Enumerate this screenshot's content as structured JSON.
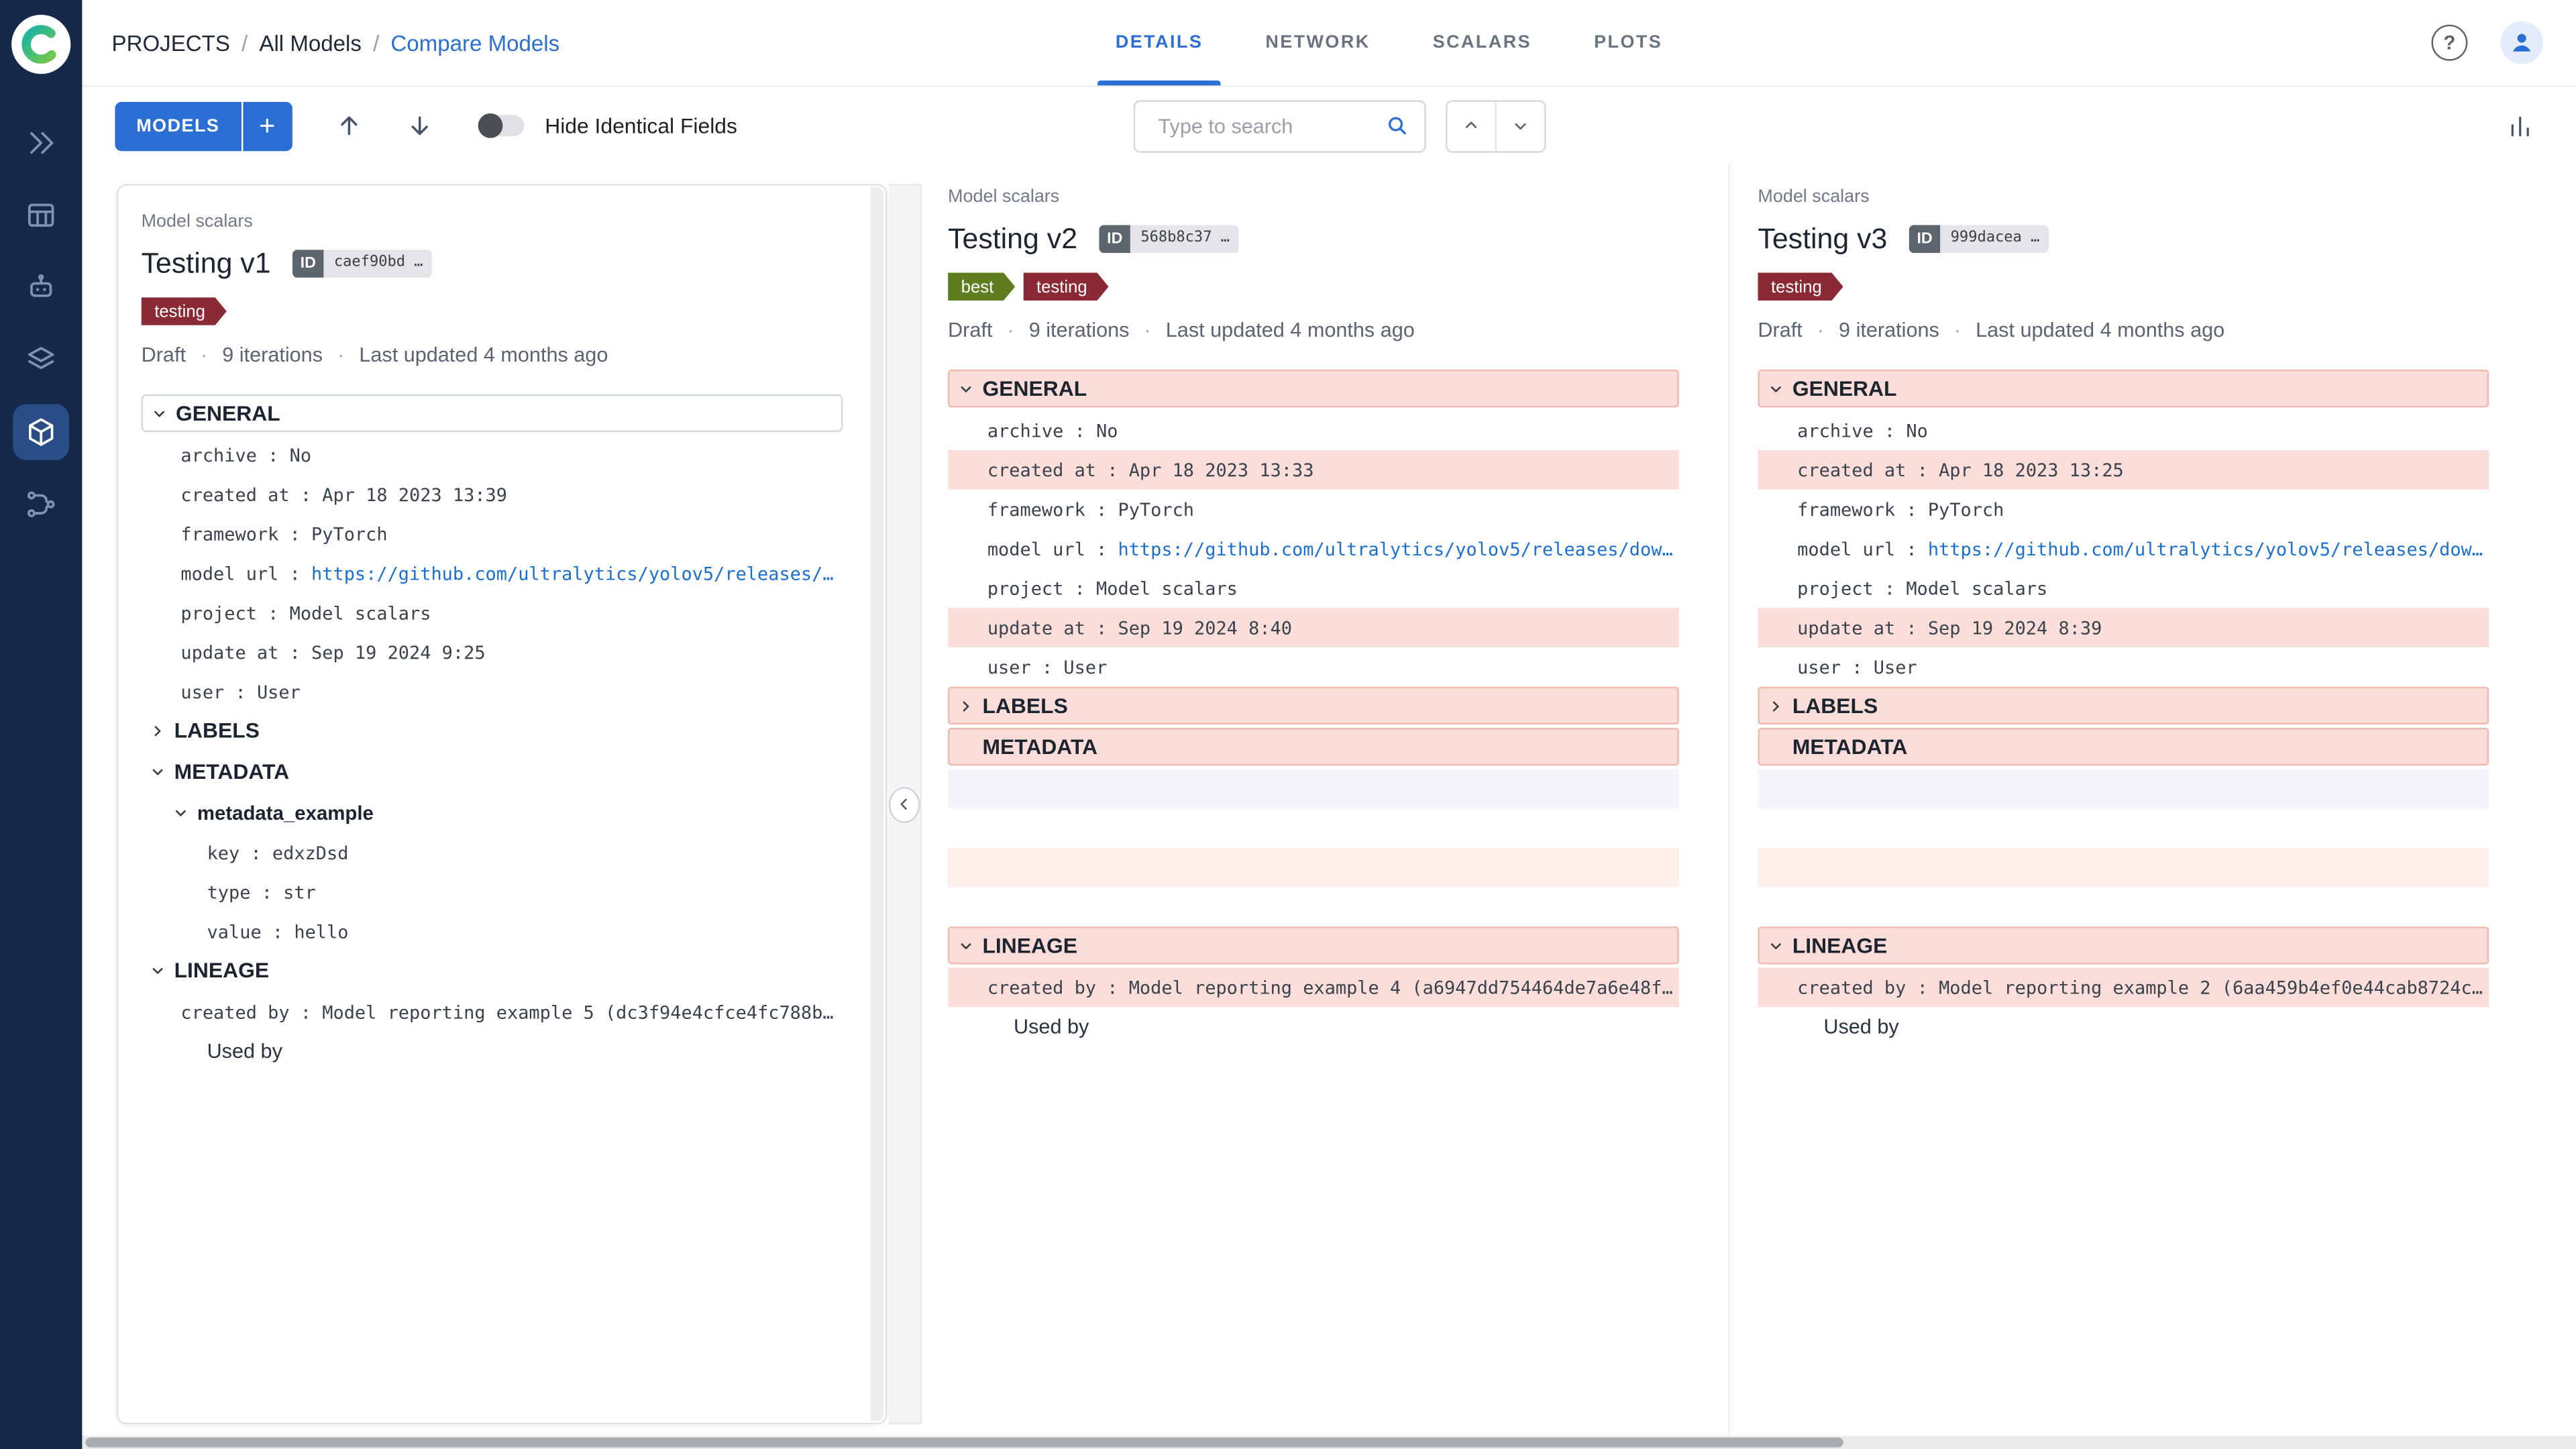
{
  "colors": {
    "accent": "#2b6fd4",
    "sidebar_bg": "#17294b",
    "diff_header_bg": "#fadcd8",
    "diff_row_bg": "#fbdeda",
    "tag_testing": "#8a2a35",
    "tag_best": "#5e7d1f"
  },
  "sidebar": {
    "logo": "comet-logo",
    "items": [
      {
        "name": "quickstart-icon",
        "active": false
      },
      {
        "name": "experiments-table-icon",
        "active": false
      },
      {
        "name": "debugger-icon",
        "active": false
      },
      {
        "name": "artifacts-icon",
        "active": false
      },
      {
        "name": "model-registry-icon",
        "active": true
      },
      {
        "name": "pipelines-icon",
        "active": false
      }
    ]
  },
  "header": {
    "breadcrumb": [
      {
        "label": "PROJECTS",
        "current": false
      },
      {
        "label": "All Models",
        "current": false
      },
      {
        "label": "Compare Models",
        "current": true
      }
    ],
    "tabs": [
      {
        "label": "DETAILS",
        "active": true
      },
      {
        "label": "NETWORK",
        "active": false
      },
      {
        "label": "SCALARS",
        "active": false
      },
      {
        "label": "PLOTS",
        "active": false
      }
    ]
  },
  "toolbar": {
    "models_button": "MODELS",
    "add_button": "+",
    "toggle_label": "Hide Identical Fields",
    "search_placeholder": "Type to search"
  },
  "models": [
    {
      "subtitle": "Model scalars",
      "title": "Testing v1",
      "id_label": "ID",
      "id_value": "caef90bd …",
      "tags": [
        {
          "label": "testing",
          "color": "#8a2a35"
        }
      ],
      "status": [
        "Draft",
        "9 iterations",
        "Last updated 4 months ago"
      ],
      "sections": [
        {
          "name": "GENERAL",
          "chevron": "down",
          "style": "boxed",
          "rows": [
            {
              "kind": "field",
              "label": "archive",
              "value": "No"
            },
            {
              "kind": "field",
              "label": "created at",
              "value": "Apr 18 2023 13:39"
            },
            {
              "kind": "field",
              "label": "framework",
              "value": "PyTorch"
            },
            {
              "kind": "field",
              "label": "model url",
              "value": "https://github.com/ultralytics/yolov5/releases/download/v6…",
              "link": true
            },
            {
              "kind": "field",
              "label": "project",
              "value": "Model scalars"
            },
            {
              "kind": "field",
              "label": "update at",
              "value": "Sep 19 2024 9:25"
            },
            {
              "kind": "field",
              "label": "user",
              "value": "User"
            }
          ]
        },
        {
          "name": "LABELS",
          "chevron": "right",
          "style": "plain",
          "rows": []
        },
        {
          "name": "METADATA",
          "chevron": "down",
          "style": "plain",
          "rows": [
            {
              "kind": "group",
              "label": "metadata_example",
              "chevron": "down"
            },
            {
              "kind": "field",
              "label": "key",
              "value": "edxzDsd",
              "indent": 2
            },
            {
              "kind": "field",
              "label": "type",
              "value": "str",
              "indent": 2
            },
            {
              "kind": "field",
              "label": "value",
              "value": "hello",
              "indent": 2
            }
          ]
        },
        {
          "name": "LINEAGE",
          "chevron": "down",
          "style": "plain",
          "rows": [
            {
              "kind": "field",
              "label": "created by",
              "value": "Model reporting example 5 (dc3f94e4cfce4fc788b911bad82f71…"
            },
            {
              "kind": "text",
              "label": "Used by"
            }
          ]
        }
      ]
    },
    {
      "subtitle": "Model scalars",
      "title": "Testing v2",
      "id_label": "ID",
      "id_value": "568b8c37 …",
      "tags": [
        {
          "label": "best",
          "color": "#5e7d1f"
        },
        {
          "label": "testing",
          "color": "#8a2a35"
        }
      ],
      "status": [
        "Draft",
        "9 iterations",
        "Last updated 4 months ago"
      ],
      "sections": [
        {
          "name": "GENERAL",
          "chevron": "down",
          "style": "pink",
          "rows": [
            {
              "kind": "field",
              "label": "archive",
              "value": "No"
            },
            {
              "kind": "field",
              "label": "created at",
              "value": "Apr 18 2023 13:33",
              "highlight": true
            },
            {
              "kind": "field",
              "label": "framework",
              "value": "PyTorch"
            },
            {
              "kind": "field",
              "label": "model url",
              "value": "https://github.com/ultralytics/yolov5/releases/download/v6…",
              "link": true
            },
            {
              "kind": "field",
              "label": "project",
              "value": "Model scalars"
            },
            {
              "kind": "field",
              "label": "update at",
              "value": "Sep 19 2024 8:40",
              "highlight": true
            },
            {
              "kind": "field",
              "label": "user",
              "value": "User"
            }
          ]
        },
        {
          "name": "LABELS",
          "chevron": "right",
          "style": "pink",
          "rows": []
        },
        {
          "name": "METADATA",
          "chevron": "none",
          "style": "pink",
          "rows": [
            {
              "kind": "empty",
              "tone": "lavender"
            },
            {
              "kind": "empty",
              "tone": "white"
            },
            {
              "kind": "empty",
              "tone": "pink"
            },
            {
              "kind": "empty",
              "tone": "white"
            }
          ]
        },
        {
          "name": "LINEAGE",
          "chevron": "down",
          "style": "pink",
          "rows": [
            {
              "kind": "field",
              "label": "created by",
              "value": "Model reporting example 4 (a6947dd754464de7a6e48f06e1a976…",
              "highlight": true
            },
            {
              "kind": "text",
              "label": "Used by"
            }
          ]
        }
      ]
    },
    {
      "subtitle": "Model scalars",
      "title": "Testing v3",
      "id_label": "ID",
      "id_value": "999dacea …",
      "tags": [
        {
          "label": "testing",
          "color": "#8a2a35"
        }
      ],
      "status": [
        "Draft",
        "9 iterations",
        "Last updated 4 months ago"
      ],
      "sections": [
        {
          "name": "GENERAL",
          "chevron": "down",
          "style": "pink",
          "rows": [
            {
              "kind": "field",
              "label": "archive",
              "value": "No"
            },
            {
              "kind": "field",
              "label": "created at",
              "value": "Apr 18 2023 13:25",
              "highlight": true
            },
            {
              "kind": "field",
              "label": "framework",
              "value": "PyTorch"
            },
            {
              "kind": "field",
              "label": "model url",
              "value": "https://github.com/ultralytics/yolov5/releases/download/v6…",
              "link": true
            },
            {
              "kind": "field",
              "label": "project",
              "value": "Model scalars"
            },
            {
              "kind": "field",
              "label": "update at",
              "value": "Sep 19 2024 8:39",
              "highlight": true
            },
            {
              "kind": "field",
              "label": "user",
              "value": "User"
            }
          ]
        },
        {
          "name": "LABELS",
          "chevron": "right",
          "style": "pink",
          "rows": []
        },
        {
          "name": "METADATA",
          "chevron": "none",
          "style": "pink",
          "rows": [
            {
              "kind": "empty",
              "tone": "lavender"
            },
            {
              "kind": "empty",
              "tone": "white"
            },
            {
              "kind": "empty",
              "tone": "pink"
            },
            {
              "kind": "empty",
              "tone": "white"
            }
          ]
        },
        {
          "name": "LINEAGE",
          "chevron": "down",
          "style": "pink",
          "rows": [
            {
              "kind": "field",
              "label": "created by",
              "value": "Model reporting example 2 (6aa459b4ef0e44cab8724c01c48e8a…",
              "highlight": true
            },
            {
              "kind": "text",
              "label": "Used by"
            }
          ]
        }
      ]
    }
  ]
}
